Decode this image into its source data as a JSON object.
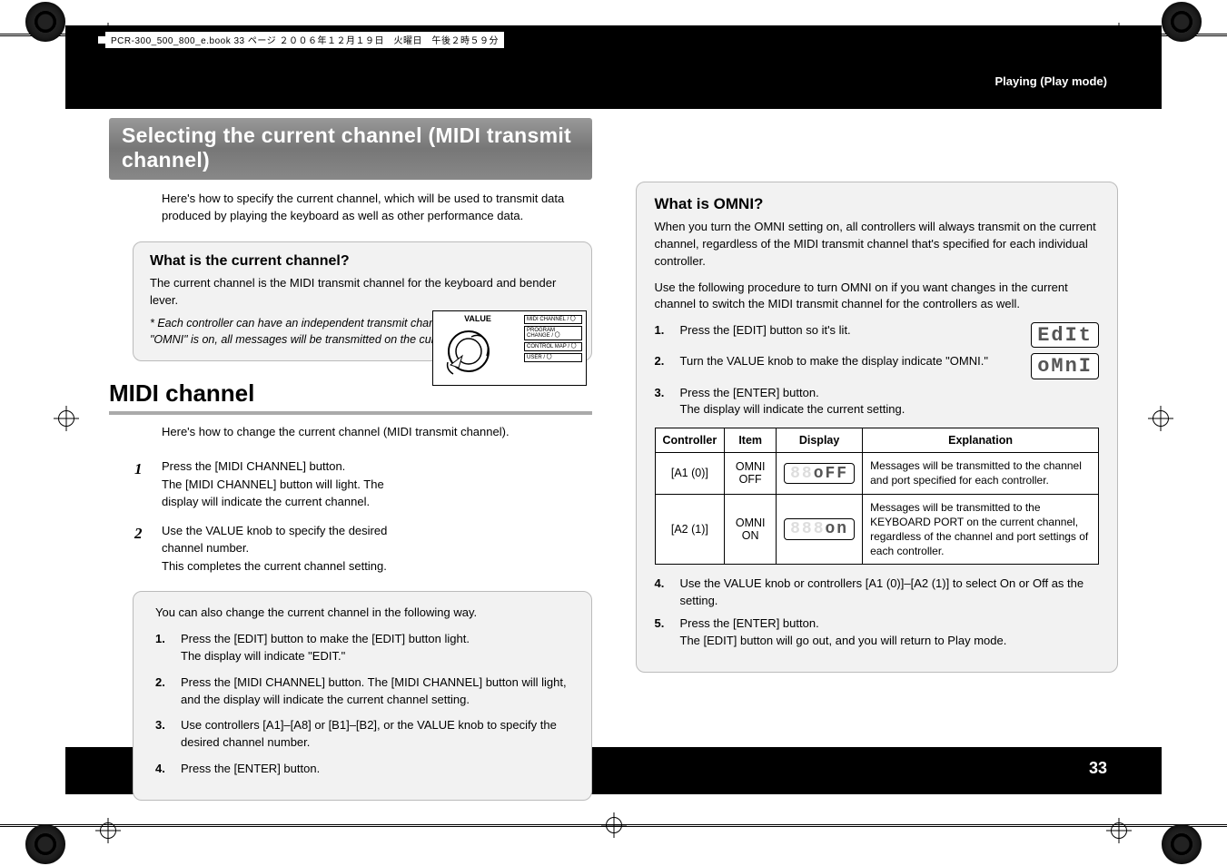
{
  "file_tag": "PCR-300_500_800_e.book  33 ページ  ２００６年１２月１９日　火曜日　午後２時５９分",
  "breadcrumb": "Playing (Play mode)",
  "page_number": "33",
  "heading_main": "Selecting the current channel (MIDI transmit channel)",
  "intro": "Here's how to specify the current channel, which will be used to transmit data produced by playing the keyboard as well as other performance data.",
  "box_current": {
    "title": "What is the current channel?",
    "body": "The current channel is the MIDI transmit channel for the keyboard and bender lever.",
    "note": "*  Each controller can have an independent transmit channel setting. However, if \"OMNI\" is on, all messages will be transmitted on the current channel."
  },
  "midi": {
    "h2": "MIDI channel",
    "intro": "Here's how to change the current channel (MIDI transmit channel).",
    "steps": [
      "Press the [MIDI CHANNEL] button.\nThe [MIDI CHANNEL] button will light. The display will indicate the current channel.",
      "Use the VALUE knob to specify the desired channel number.\nThis completes the current channel setting."
    ],
    "labels": {
      "value": "VALUE",
      "l1": "MIDI CHANNEL / 〇",
      "l2": "PROGRAM CHANGE / 〇",
      "l3": "CONTROL MAP / 〇",
      "l4": "USER / 〇"
    }
  },
  "alt_box": {
    "lead": "You can also change the current channel in the following way.",
    "steps": [
      "Press the [EDIT] button to make the [EDIT] button light.\nThe display will indicate \"EDIT.\"",
      "Press the [MIDI CHANNEL] button. The [MIDI CHANNEL] button will light, and the display will indicate the current channel setting.",
      "Use controllers [A1]–[A8] or [B1]–[B2], or the VALUE knob to specify the desired channel number.",
      "Press the [ENTER] button."
    ]
  },
  "omni": {
    "title": "What is OMNI?",
    "p1": "When you turn the OMNI setting on, all controllers will always transmit on the current channel, regardless of the MIDI transmit channel that's specified for each individual controller.",
    "p2": "Use the following procedure to turn OMNI on if you want changes in the current channel to switch the MIDI transmit channel for the controllers as well.",
    "steps_top": [
      {
        "n": "1.",
        "t": "Press the [EDIT] button so it's lit.",
        "d": "EdIt"
      },
      {
        "n": "2.",
        "t": "Turn the VALUE knob to make the display indicate \"OMNI.\"",
        "d": "oMnI"
      },
      {
        "n": "3.",
        "t": "Press the [ENTER] button.\nThe display will indicate the current setting.",
        "d": ""
      }
    ],
    "table": {
      "headers": [
        "Controller",
        "Item",
        "Display",
        "Explanation"
      ],
      "rows": [
        {
          "c": "[A1 (0)]",
          "i": "OMNI OFF",
          "d": "oFF",
          "e": "Messages will be transmitted to the channel and port specified for each controller."
        },
        {
          "c": "[A2 (1)]",
          "i": "OMNI ON",
          "d": "on",
          "e": "Messages will be transmitted to the KEYBOARD PORT on the current channel, regardless of the channel and port settings of each controller."
        }
      ]
    },
    "steps_bottom": [
      {
        "n": "4.",
        "t": "Use the VALUE knob or controllers [A1 (0)]–[A2 (1)] to select On or Off as the setting."
      },
      {
        "n": "5.",
        "t": "Press the [ENTER] button.\nThe [EDIT] button will go out, and you will return to Play mode."
      }
    ]
  }
}
